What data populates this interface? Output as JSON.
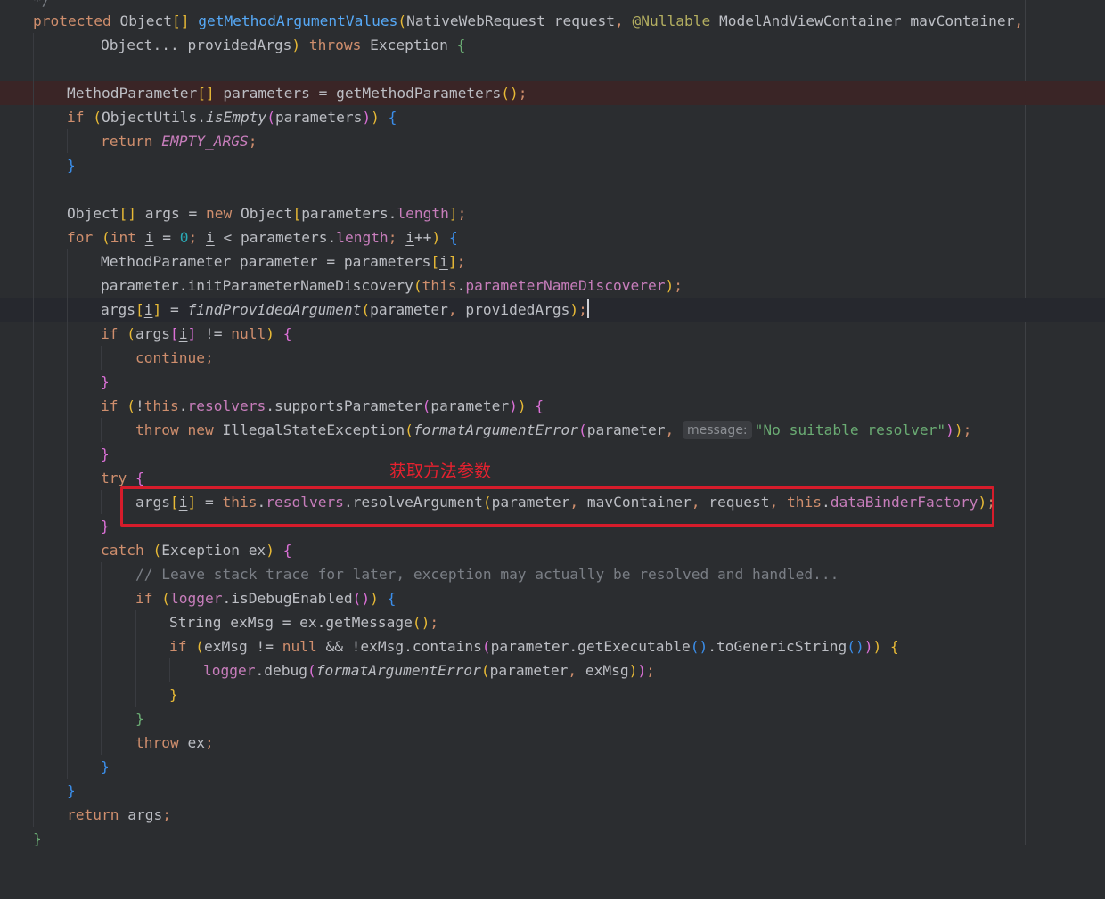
{
  "editor": {
    "language": "Java",
    "theme_colors": {
      "background": "#2b2d30",
      "keyword": "#cf8e6d",
      "method": "#56a8f5",
      "field": "#c77dbb",
      "number": "#2aacb8",
      "string": "#6aab73",
      "annotation": "#b3ae60",
      "comment": "#7a7e85",
      "callout": "#d61c2b"
    },
    "lines": [
      {
        "t": "*/"
      },
      {
        "t": "protected Object[] getMethodArgumentValues(NativeWebRequest request, @Nullable ModelAndViewContainer mavContainer,"
      },
      {
        "t": "Object... providedArgs) throws Exception {"
      },
      {
        "t": ""
      },
      {
        "t": "MethodParameter[] parameters = getMethodParameters();",
        "state": "error-highlight"
      },
      {
        "t": "if (ObjectUtils.isEmpty(parameters)) {"
      },
      {
        "t": "return EMPTY_ARGS;"
      },
      {
        "t": "}"
      },
      {
        "t": ""
      },
      {
        "t": "Object[] args = new Object[parameters.length];"
      },
      {
        "t": "for (int i = 0; i < parameters.length; i++) {"
      },
      {
        "t": "MethodParameter parameter = parameters[i];"
      },
      {
        "t": "parameter.initParameterNameDiscovery(this.parameterNameDiscoverer);"
      },
      {
        "t": "args[i] = findProvidedArgument(parameter, providedArgs);",
        "state": "current-line"
      },
      {
        "t": "if (args[i] != null) {"
      },
      {
        "t": "continue;"
      },
      {
        "t": "}"
      },
      {
        "t": "if (!this.resolvers.supportsParameter(parameter)) {"
      },
      {
        "t": "throw new IllegalStateException(formatArgumentError(parameter, \"No suitable resolver\"));",
        "inlay_hint": "message:"
      },
      {
        "t": "}"
      },
      {
        "t": "try {"
      },
      {
        "t": "args[i] = this.resolvers.resolveArgument(parameter, mavContainer, request, this.dataBinderFactory);"
      },
      {
        "t": "}"
      },
      {
        "t": "catch (Exception ex) {"
      },
      {
        "t": "// Leave stack trace for later, exception may actually be resolved and handled..."
      },
      {
        "t": "if (logger.isDebugEnabled()) {"
      },
      {
        "t": "String exMsg = ex.getMessage();"
      },
      {
        "t": "if (exMsg != null && !exMsg.contains(parameter.getExecutable().toGenericString())) {"
      },
      {
        "t": "logger.debug(formatArgumentError(parameter, exMsg));"
      },
      {
        "t": "}"
      },
      {
        "t": "}"
      },
      {
        "t": "throw ex;"
      },
      {
        "t": "}"
      },
      {
        "t": "}"
      },
      {
        "t": "return args;"
      },
      {
        "t": "}"
      }
    ]
  },
  "annotation": {
    "label": "获取方法参数"
  }
}
